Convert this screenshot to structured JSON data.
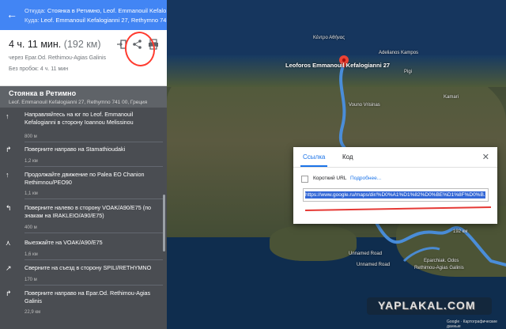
{
  "sidebar": {
    "from_label": "Откуда:",
    "from_value": "Стоянка в Ретимно, Leof. Emmanouil Kefalo...",
    "to_label": "Куда:",
    "to_value": "Leof. Emmanouil Kefalogianni 27, Rethymno 74...",
    "duration": "4 ч. 11 мин.",
    "distance": "(192 км)",
    "via": "через Epar.Od. Rethimou-Agias Galinis",
    "traffic": "Без пробок: 4 ч. 11 мин",
    "destination_title": "Стоянка в Ретимно",
    "destination_address": "Leof. Emmanouil Kefalogianni 27, Rethymno 741 00, Греция",
    "steps": [
      {
        "icon": "straight-arrow-icon",
        "glyph": "↑",
        "text": "Направляйтесь на юг по Leof. Emmanouil Kefalogianni в сторону Ioannou Melissinou",
        "dist": "800 м"
      },
      {
        "icon": "turn-right-icon",
        "glyph": "↱",
        "text": "Поверните направо на Stamathioudaki",
        "dist": "1,2 км"
      },
      {
        "icon": "straight-arrow-icon",
        "glyph": "↑",
        "text": "Продолжайте движение по Palea EO Chanion Rethimnou/PEO90",
        "dist": "1,1 км"
      },
      {
        "icon": "turn-left-icon",
        "glyph": "↰",
        "text": "Поверните налево в сторону VOAK/A90/E75 (по знакам на IRAKLEIO/A90/E75)",
        "dist": "400 м"
      },
      {
        "icon": "merge-icon",
        "glyph": "⋏",
        "text": "Выезжайте на VOAK/A90/E75",
        "dist": "1,6 км"
      },
      {
        "icon": "exit-right-icon",
        "glyph": "↗",
        "text": "Сверните на съезд в сторону SPILI/RETHYMNO",
        "dist": "170 м"
      },
      {
        "icon": "turn-right-icon",
        "glyph": "↱",
        "text": "Поверните направо на Epar.Od. Rethimou-Agias Galinis",
        "dist": "22,9 км"
      }
    ]
  },
  "map": {
    "labels": {
      "pin_title": "Leoforos Emmanouil Kefalogianni 27",
      "greek_top": "Κέντρο Αθήνας",
      "vouno": "Vouno Vrisinas",
      "unnamed1": "Unnamed Road",
      "unnamed2": "Unnamed Road",
      "eparchiak": "Eparchiak. Odos",
      "rethimou": "Rethimou-Agias Galinis",
      "km_label": "192 км",
      "adelianos": "Adelianos Kampos",
      "pigi": "Pigi",
      "kamari": "Kamari"
    }
  },
  "dialog": {
    "tab_link": "Ссылка",
    "tab_code": "Код",
    "short_url_label": "Короткий URL",
    "more_link": "Подробнее...",
    "url_value": "https://www.google.ru/maps/dir/%D0%A1%D1%82%D0%BE%D1%8F%D0%B..."
  },
  "watermark": {
    "brand": "YAPLAKAL.COM",
    "map_data": "Google · Картографические данные"
  },
  "colors": {
    "accent": "#4285f4",
    "route": "#4a90e2",
    "annotation_red": "#e53935"
  }
}
